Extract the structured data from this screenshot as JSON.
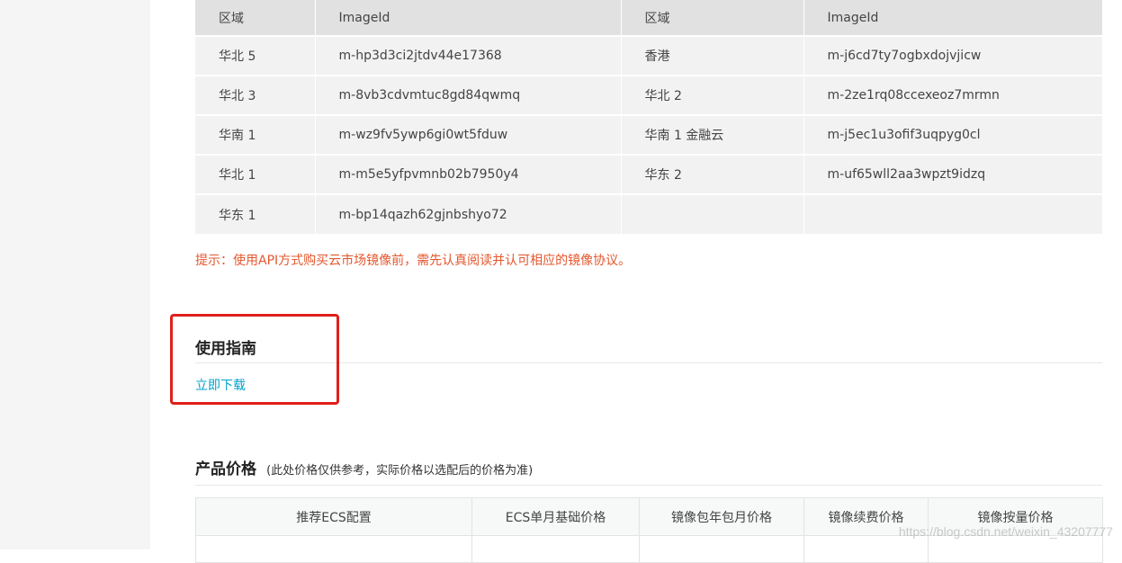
{
  "image_table": {
    "headers": [
      "区域",
      "ImageId",
      "区域",
      "ImageId"
    ],
    "rows": [
      [
        "华北 5",
        "m-hp3d3ci2jtdv44e17368",
        "香港",
        "m-j6cd7ty7ogbxdojvjicw"
      ],
      [
        "华北 3",
        "m-8vb3cdvmtuc8gd84qwmq",
        "华北 2",
        "m-2ze1rq08ccexeoz7mrmn"
      ],
      [
        "华南 1",
        "m-wz9fv5ywp6gi0wt5fduw",
        "华南 1 金融云",
        "m-j5ec1u3ofif3uqpyg0cl"
      ],
      [
        "华北 1",
        "m-m5e5yfpvmnb02b7950y4",
        "华东 2",
        "m-uf65wll2aa3wpzt9idzq"
      ],
      [
        "华东 1",
        "m-bp14qazh62gjnbshyo72",
        "",
        ""
      ]
    ]
  },
  "tip": "提示：使用API方式购买云市场镜像前，需先认真阅读并认可相应的镜像协议。",
  "guide": {
    "title": "使用指南",
    "link": "立即下载"
  },
  "price": {
    "title": "产品价格",
    "note": "(此处价格仅供参考，实际价格以选配后的价格为准)",
    "headers": [
      "推荐ECS配置",
      "ECS单月基础价格",
      "镜像包年包月价格",
      "镜像续费价格",
      "镜像按量价格"
    ]
  },
  "watermark": "https://blog.csdn.net/weixin_43207777",
  "colors": {
    "tip": "#e4572e",
    "link": "#00a2ca",
    "highlight": "#e0201b"
  }
}
